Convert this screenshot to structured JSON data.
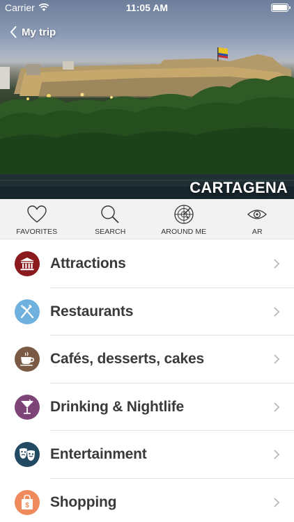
{
  "status_bar": {
    "carrier": "Carrier",
    "time": "11:05 AM"
  },
  "nav": {
    "back_label": "My trip"
  },
  "hero": {
    "city": "CARTAGENA"
  },
  "toolbar": {
    "items": [
      {
        "label": "FAVORITES",
        "icon": "heart-icon"
      },
      {
        "label": "SEARCH",
        "icon": "magnifier-icon"
      },
      {
        "label": "AROUND ME",
        "icon": "radar-icon"
      },
      {
        "label": "AR",
        "icon": "eye-icon"
      }
    ]
  },
  "categories": [
    {
      "label": "Attractions",
      "icon": "museum-icon",
      "color": "#8b1a1f"
    },
    {
      "label": "Restaurants",
      "icon": "fork-knife-icon",
      "color": "#6fb1de"
    },
    {
      "label": "Cafés, desserts, cakes",
      "icon": "coffee-cup-icon",
      "color": "#7a5a45"
    },
    {
      "label": "Drinking & Nightlife",
      "icon": "cocktail-icon",
      "color": "#7d4478"
    },
    {
      "label": "Entertainment",
      "icon": "theater-masks-icon",
      "color": "#234a63"
    },
    {
      "label": "Shopping",
      "icon": "shopping-bag-icon",
      "color": "#ee8a5c"
    }
  ]
}
